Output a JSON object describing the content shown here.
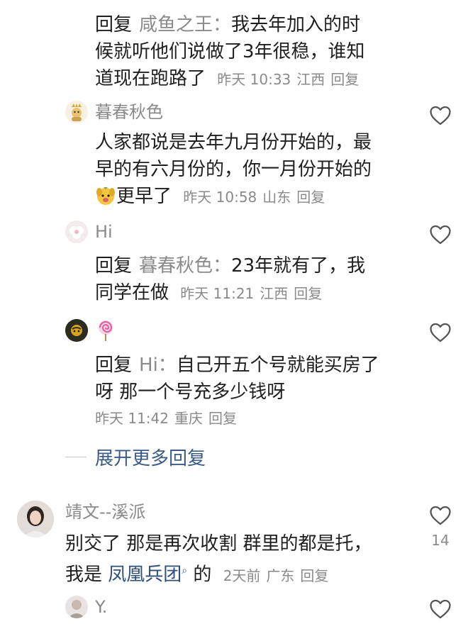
{
  "comments": [
    {
      "reply_label": "回复",
      "mention": "咸鱼之王：",
      "text_line1": "我去年加入的时",
      "text_line2": "候就听他们说做了3年很稳，谁知",
      "text_line3": "道现在跑路了",
      "time": "昨天 10:33",
      "region": "江西",
      "reply": "回复"
    },
    {
      "username": "暮春秋色",
      "text_line1": "人家都说是去年九月份开始的，最",
      "text_line2": "早的有六月份的，你一月份开始的",
      "text_line3": "更早了",
      "time": "昨天 10:58",
      "region": "山东",
      "reply": "回复"
    },
    {
      "username": "Hi",
      "reply_label": "回复",
      "mention": "暮春秋色：",
      "text_line1": "23年就有了，我",
      "text_line2": "同学在做",
      "time": "昨天 11:21",
      "region": "江西",
      "reply": "回复"
    },
    {
      "username_icon": "lollipop",
      "reply_label": "回复",
      "mention": "Hi：",
      "text_line1": "自己开五个号就能买房了",
      "text_line2": "呀 那一个号充多少钱呀",
      "time": "昨天 11:42",
      "region": "重庆",
      "reply": "回复"
    }
  ],
  "expand_more": "展开更多回复",
  "top_comment": {
    "username": "靖文--溪派",
    "text_line1": "别交了 那是再次收割 群里的都是托，",
    "text_prefix": "我是",
    "group_name": "凤凰兵团",
    "text_suffix": "的",
    "time": "2天前",
    "region": "广东",
    "reply": "回复",
    "likes": "14"
  },
  "next_comment": {
    "username": "Y."
  },
  "icons": {
    "like": "heart-outline-icon",
    "search": "search-mini-icon"
  },
  "colors": {
    "text": "#1f1f1f",
    "meta": "#8a8a8a",
    "link": "#3b5b86"
  }
}
